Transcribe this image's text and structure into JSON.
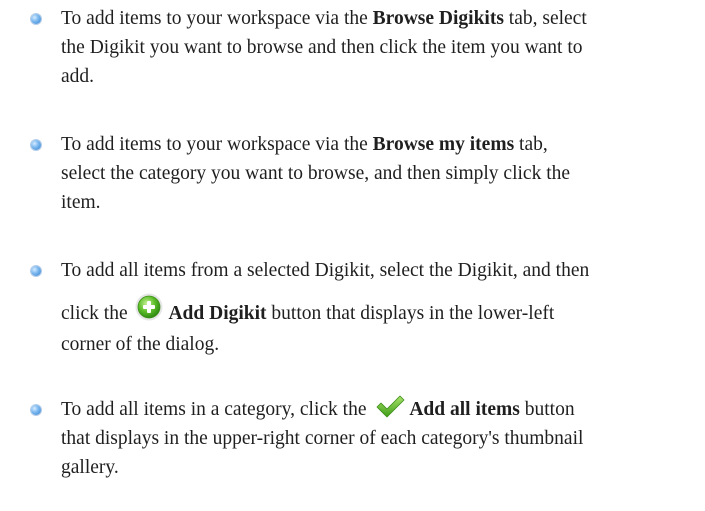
{
  "icons": {
    "bullet": "blue-bullet-icon",
    "add_digikit": "green-plus-circle-icon",
    "add_all_items": "green-checkmark-icon"
  },
  "items": [
    {
      "l1_pre": "To add items to your workspace via the ",
      "l1_bold": "Browse Digikits",
      "l1_post": " tab, select",
      "l2": "the Digikit you want to browse and then click the item you want to",
      "l3": "add."
    },
    {
      "l1_pre": "To add items to your workspace via the ",
      "l1_bold": "Browse my items",
      "l1_post": " tab,",
      "l2": "select the category you want to browse, and then simply click the",
      "l3": "item."
    },
    {
      "l1": "To add all items from a selected Digikit, select the Digikit, and then",
      "l2_pre": "click the ",
      "l2_bold": "Add Digikit",
      "l2_post": " button that displays in the lower-left",
      "l3": "corner of the dialog."
    },
    {
      "l1_pre": "To add all items in a category, click the ",
      "l1_bold": "Add all items",
      "l1_post": " button",
      "l2": "that displays in the upper-right corner of each category's thumbnail",
      "l3": "gallery."
    }
  ]
}
